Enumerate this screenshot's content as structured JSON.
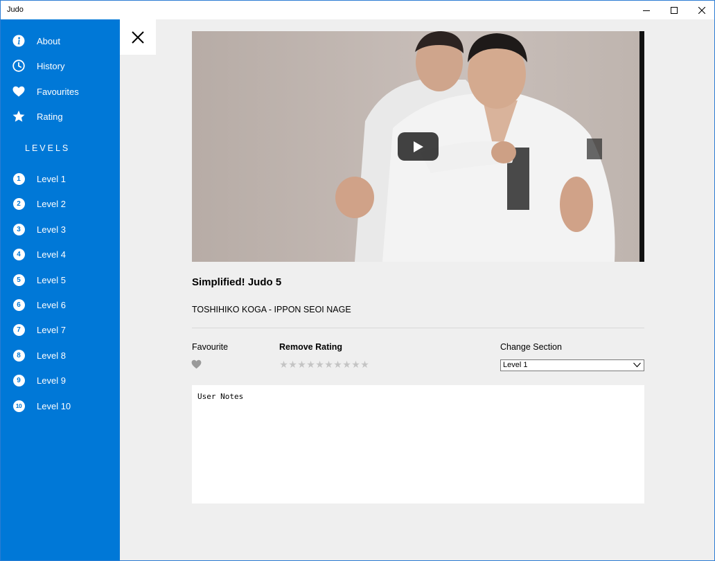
{
  "window": {
    "title": "Judo",
    "minimize_icon": "minimize-icon",
    "maximize_icon": "maximize-icon",
    "close_icon": "close-icon"
  },
  "sidebar": {
    "background": "#0078d7",
    "items": [
      {
        "label": "About",
        "icon": "info-icon"
      },
      {
        "label": "History",
        "icon": "clock-icon"
      },
      {
        "label": "Favourites",
        "icon": "heart-icon"
      },
      {
        "label": "Rating",
        "icon": "star-icon"
      }
    ],
    "levels_heading": "LEVELS",
    "levels": [
      {
        "number": "1",
        "label": "Level 1"
      },
      {
        "number": "2",
        "label": "Level 2"
      },
      {
        "number": "3",
        "label": "Level 3"
      },
      {
        "number": "4",
        "label": "Level 4"
      },
      {
        "number": "5",
        "label": "Level 5"
      },
      {
        "number": "6",
        "label": "Level 6"
      },
      {
        "number": "7",
        "label": "Level 7"
      },
      {
        "number": "8",
        "label": "Level 8"
      },
      {
        "number": "9",
        "label": "Level 9"
      },
      {
        "number": "10",
        "label": "Level 10"
      }
    ]
  },
  "pane_close_icon": "close-x-icon",
  "video": {
    "play_icon": "play-icon",
    "title": "Simplified! Judo 5",
    "subtitle": "TOSHIHIKO KOGA - IPPON SEOI NAGE"
  },
  "details": {
    "favourite_label": "Favourite",
    "favourite_icon": "heart-outline-icon",
    "rating_label": "Remove Rating",
    "rating_max": 10,
    "rating_value": 0,
    "section_label": "Change Section",
    "section_selected": "Level 1"
  },
  "notes": {
    "value": "User Notes"
  }
}
